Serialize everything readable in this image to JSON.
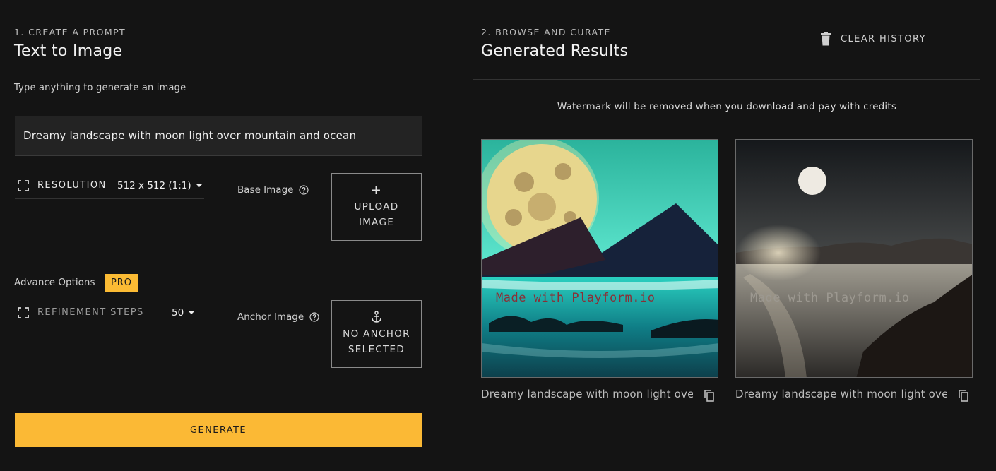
{
  "left_panel": {
    "step_label": "1. CREATE A PROMPT",
    "title": "Text to Image",
    "hint": "Type anything to generate an image",
    "prompt_value": "Dreamy landscape with moon light over mountain and ocean",
    "resolution": {
      "label": "RESOLUTION",
      "value": "512 x 512 (1:1)"
    },
    "base_image": {
      "label": "Base Image",
      "upload_line1": "UPLOAD",
      "upload_line2": "IMAGE"
    },
    "advance_options": {
      "label": "Advance Options",
      "badge": "PRO"
    },
    "refinement_steps": {
      "label": "REFINEMENT STEPS",
      "value": "50"
    },
    "anchor_image": {
      "label": "Anchor Image",
      "box_line1": "NO ANCHOR",
      "box_line2": "SELECTED"
    },
    "generate_label": "GENERATE"
  },
  "right_panel": {
    "step_label": "2. BROWSE AND CURATE",
    "title": "Generated Results",
    "clear_history_label": "CLEAR HISTORY",
    "watermark_note": "Watermark will be removed when you download and pay with credits",
    "results": [
      {
        "caption": "Dreamy landscape with moon light ove...",
        "watermark": "Made with Playform.io"
      },
      {
        "caption": "Dreamy landscape with moon light ove...",
        "watermark": "Made with Playform.io"
      }
    ]
  },
  "icons": {
    "expand": "expand-corners-icon",
    "help": "help-circle-icon",
    "plus": "plus-icon",
    "anchor": "anchor-icon",
    "trash": "trash-icon",
    "copy": "copy-icon",
    "caret": "caret-down-icon"
  },
  "colors": {
    "background": "#141414",
    "accent": "#fbb935",
    "prompt_bg": "#232323"
  }
}
